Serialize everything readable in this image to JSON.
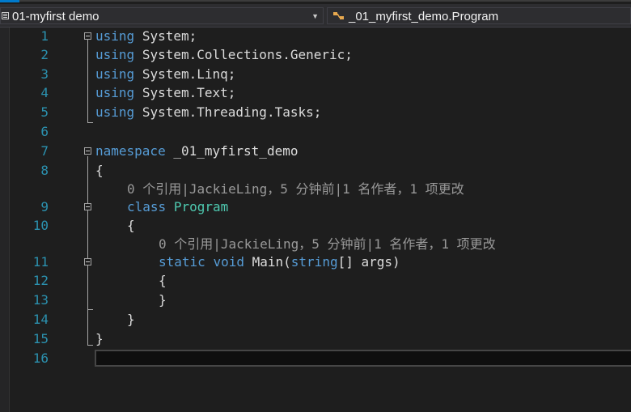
{
  "nav": {
    "project": "01-myfirst demo",
    "class_path": "_01_myfirst_demo.Program"
  },
  "code": {
    "line_numbers": [
      "1",
      "2",
      "3",
      "4",
      "5",
      "6",
      "7",
      "8",
      "9",
      "10",
      "11",
      "12",
      "13",
      "14",
      "15",
      "16"
    ],
    "using_kw": "using",
    "usings": [
      "System;",
      "System.Collections.Generic;",
      "System.Linq;",
      "System.Text;",
      "System.Threading.Tasks;"
    ],
    "namespace_kw": "namespace",
    "namespace_name": "_01_myfirst_demo",
    "open_brace": "{",
    "close_brace": "}",
    "codelens_class": "0 个引用|JackieLing，5 分钟前|1 名作者，1 项更改",
    "codelens_method": "0 个引用|JackieLing，5 分钟前|1 名作者，1 项更改",
    "class_kw": "class",
    "class_name": "Program",
    "static_kw": "static",
    "void_kw": "void",
    "method_name": "Main(",
    "string_kw": "string",
    "method_rest": "[] args)"
  },
  "colors": {
    "keyword": "#569cd6",
    "type": "#4ec9b0",
    "line_number": "#2b91af",
    "codelens": "#999999",
    "text": "#dcdcdc",
    "background": "#1e1e1e"
  },
  "icons": [
    "project-icon",
    "dropdown-arrow-icon",
    "class-icon",
    "collapse-icon"
  ]
}
